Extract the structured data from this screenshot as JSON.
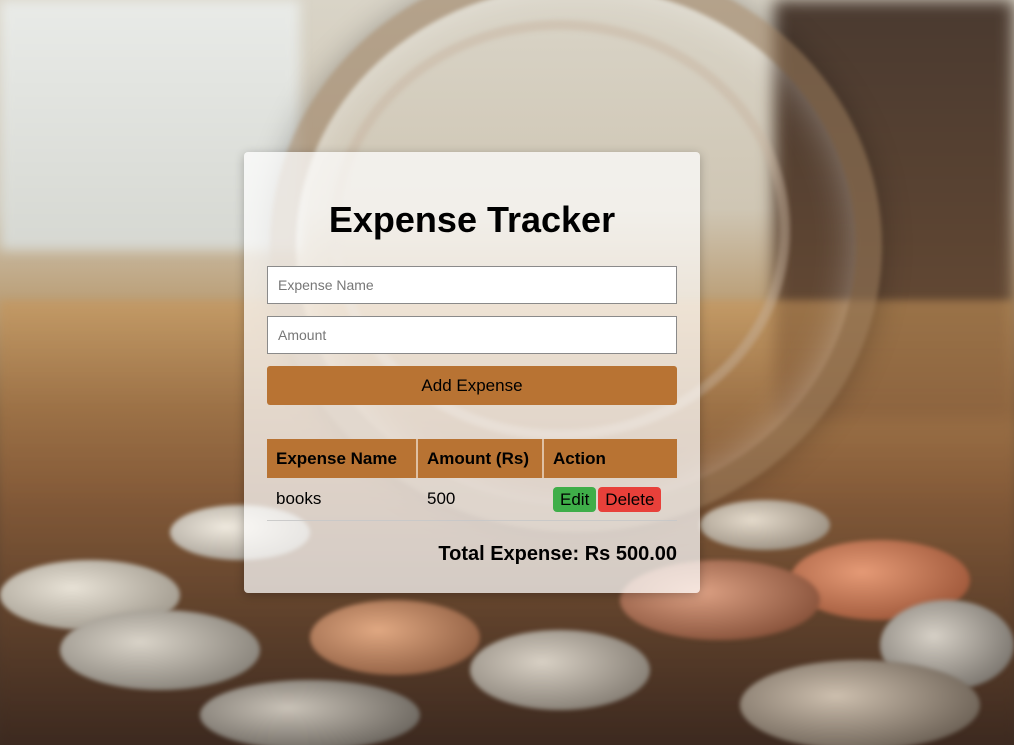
{
  "app": {
    "title": "Expense Tracker"
  },
  "form": {
    "name_placeholder": "Expense Name",
    "name_value": "",
    "amount_placeholder": "Amount",
    "amount_value": "",
    "add_label": "Add Expense"
  },
  "table": {
    "headers": [
      "Expense Name",
      "Amount (Rs)",
      "Action"
    ],
    "rows": [
      {
        "name": "books",
        "amount": "500",
        "edit_label": "Edit",
        "delete_label": "Delete"
      }
    ]
  },
  "total": {
    "text": "Total Expense: Rs 500.00"
  },
  "colors": {
    "accent": "#b87333",
    "edit": "#3fae49",
    "delete": "#e8403a"
  }
}
